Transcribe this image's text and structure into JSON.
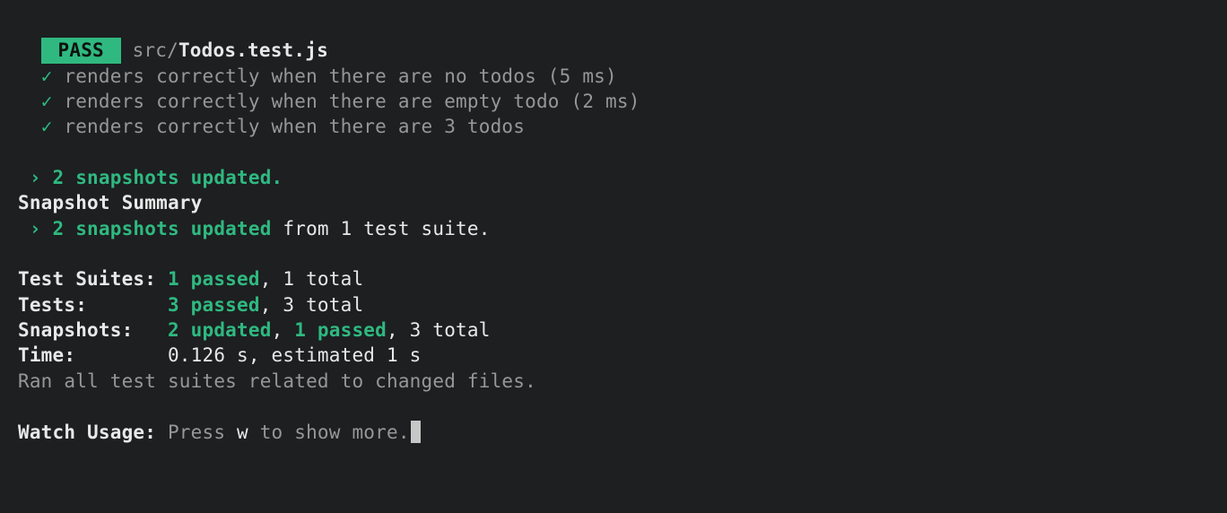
{
  "header": {
    "badge": " PASS ",
    "path_prefix": "src/",
    "path_bold": "Todos.test.js"
  },
  "tests": [
    {
      "check": "✓",
      "name": "renders correctly when there are no todos",
      "timing": " (5 ms)"
    },
    {
      "check": "✓",
      "name": "renders correctly when there are empty todo",
      "timing": " (2 ms)"
    },
    {
      "check": "✓",
      "name": "renders correctly when there are 3 todos",
      "timing": ""
    }
  ],
  "snapshots_updated_line": {
    "marker": " › ",
    "text": "2 snapshots updated."
  },
  "snapshot_summary_label": "Snapshot Summary",
  "snapshot_summary_detail": {
    "marker": " › ",
    "count_text": "2 snapshots ",
    "updated_text": "updated",
    "suffix": " from 1 test suite."
  },
  "stats": {
    "suites": {
      "label": "Test Suites: ",
      "passed": "1 passed",
      "rest": ", 1 total"
    },
    "tests": {
      "label": "Tests:       ",
      "passed": "3 passed",
      "rest": ", 3 total"
    },
    "snapshots": {
      "label": "Snapshots:   ",
      "updated": "2 updated",
      "sep": ", ",
      "passed": "1 passed",
      "rest": ", 3 total"
    },
    "time": {
      "label": "Time:        ",
      "value": "0.126 s, estimated 1 s"
    }
  },
  "ran_line": "Ran all test suites related to changed files.",
  "watch": {
    "label": "Watch Usage:",
    "press": " Press ",
    "key": "w",
    "rest": " to show more."
  }
}
